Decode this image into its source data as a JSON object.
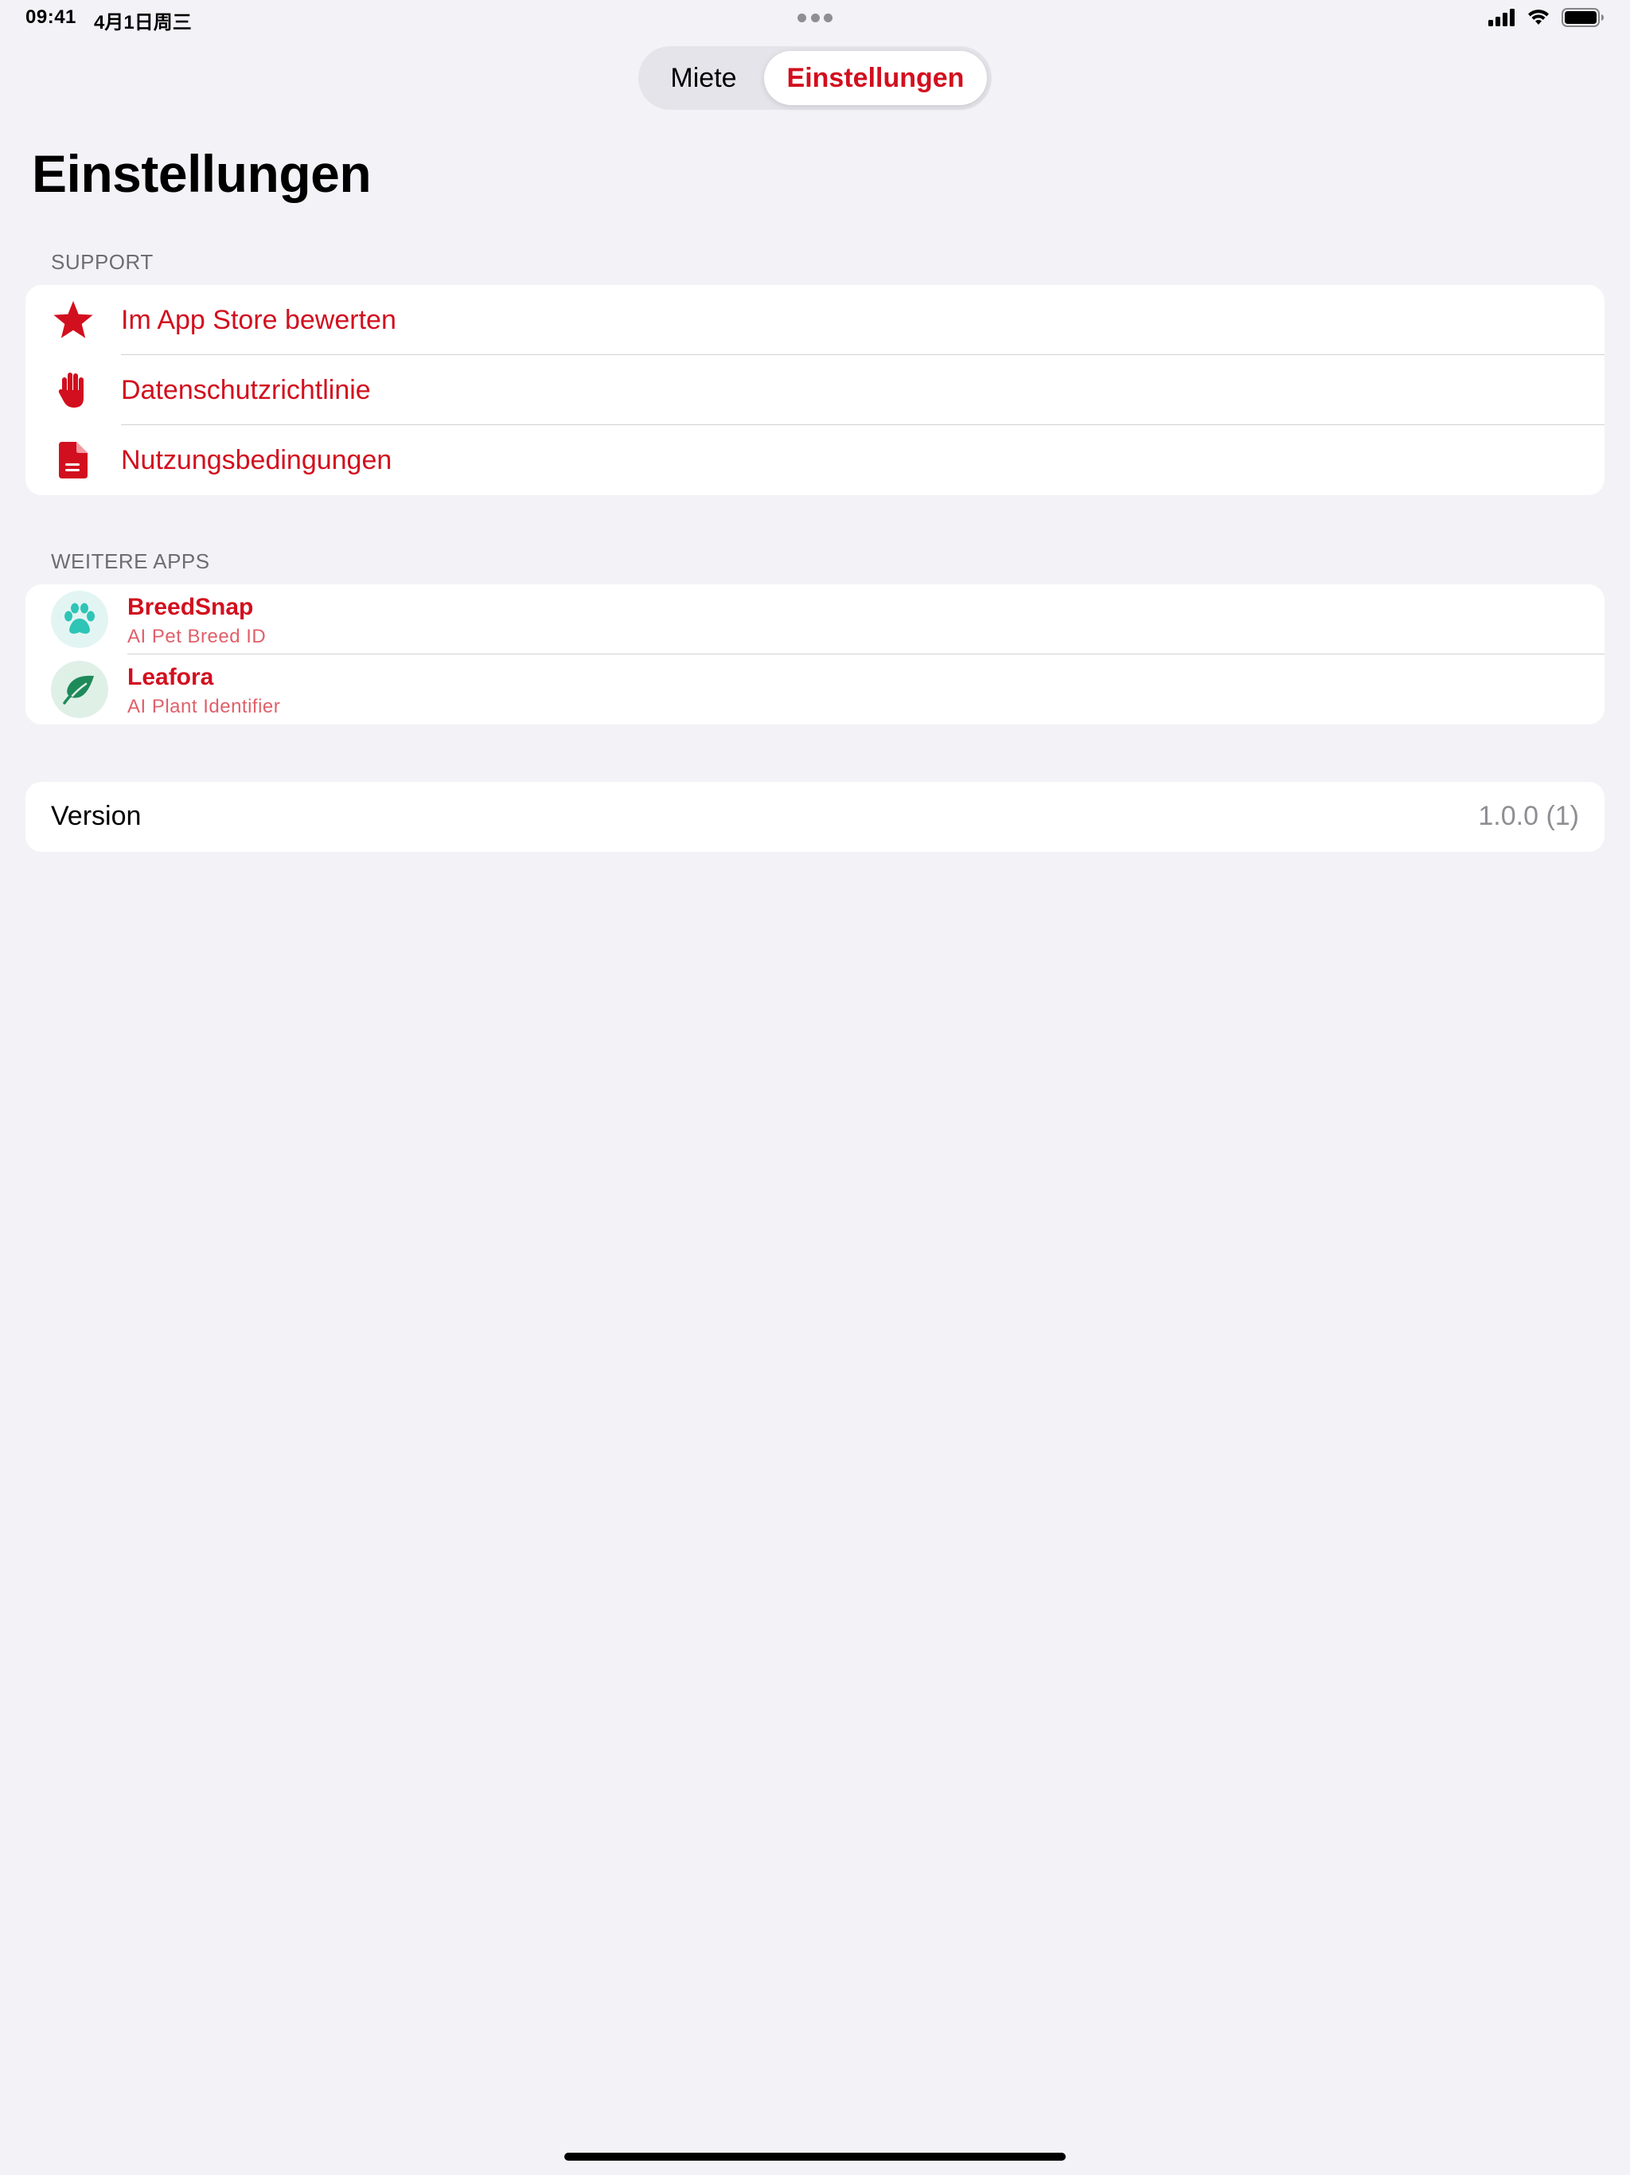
{
  "status_bar": {
    "time": "09:41",
    "date": "4月1日周三",
    "icons": [
      "cellular-signal-icon",
      "wifi-icon",
      "battery-icon"
    ]
  },
  "segmented_control": {
    "segments": [
      {
        "label": "Miete",
        "selected": false
      },
      {
        "label": "Einstellungen",
        "selected": true
      }
    ]
  },
  "page_title": "Einstellungen",
  "support": {
    "header": "SUPPORT",
    "items": [
      {
        "label": "Im App Store bewerten",
        "icon": "star-icon"
      },
      {
        "label": "Datenschutzrichtlinie",
        "icon": "hand-raised-icon"
      },
      {
        "label": "Nutzungsbedingungen",
        "icon": "document-icon"
      }
    ]
  },
  "more_apps": {
    "header": "WEITERE APPS",
    "items": [
      {
        "name": "BreedSnap",
        "subtitle": "AI Pet Breed ID",
        "icon": "paw-icon"
      },
      {
        "name": "Leafora",
        "subtitle": "AI Plant Identifier",
        "icon": "leaf-icon"
      }
    ]
  },
  "version": {
    "label": "Version",
    "value": "1.0.0 (1)"
  },
  "colors": {
    "accent": "#d20f1e",
    "background": "#f2f2f7",
    "breedsnap": "#2ec4b6",
    "leafora": "#1e8a5a"
  }
}
